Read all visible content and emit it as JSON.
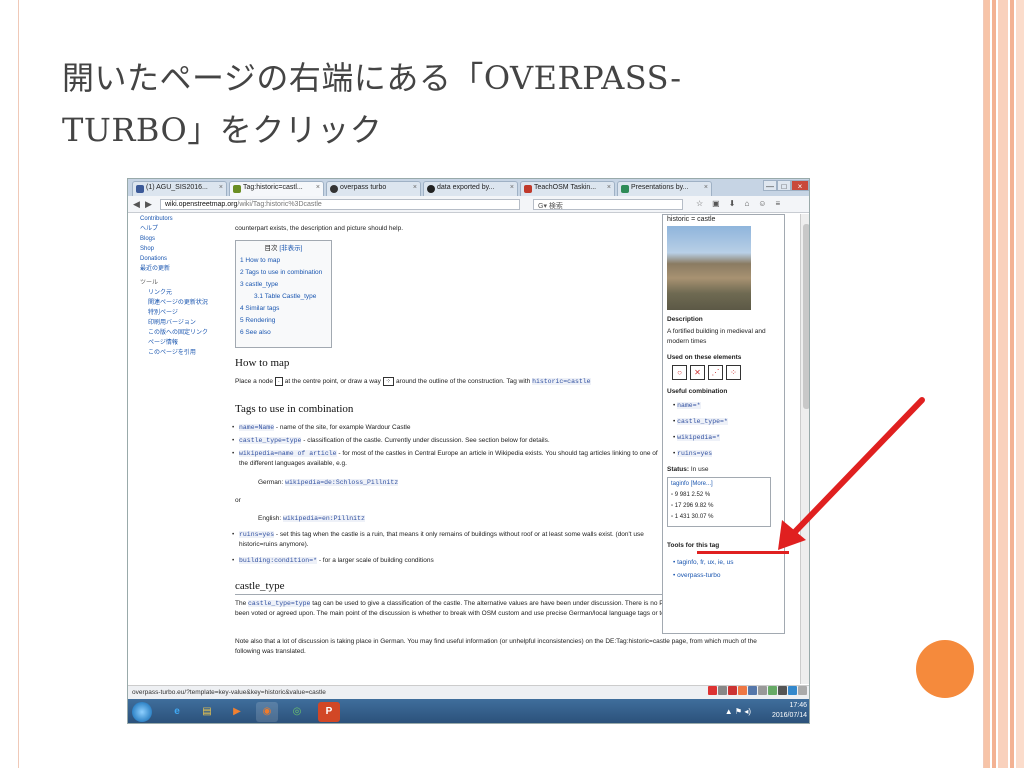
{
  "slide": {
    "title_line1": "開いたページの右端にある「OVERPASS-",
    "title_line2": "TURBO」をクリック"
  },
  "browser": {
    "tabs": [
      {
        "label": "(1) AGU_SIS2016...",
        "color": "#3b5998"
      },
      {
        "label": "Tag:historic=castl...",
        "color": "#6b8e23"
      },
      {
        "label": "overpass turbo",
        "color": "#333333"
      },
      {
        "label": "data exported by...",
        "color": "#222222"
      },
      {
        "label": "TeachOSM Taskin...",
        "color": "#c0392b"
      },
      {
        "label": "Presentations by...",
        "color": "#2e8b57"
      }
    ],
    "tab_close": "×",
    "window_buttons": [
      "—",
      "□",
      "×"
    ],
    "back": "◀",
    "forward": "▶",
    "url_host": "wiki.openstreetmap.org",
    "url_path": "/wiki/Tag:historic%3Dcastle",
    "search_placeholder": "検索",
    "toolbar_icons": [
      "☆",
      "▣",
      "⬇",
      "⌂",
      "☺",
      "≡"
    ]
  },
  "sidebar": {
    "items_top": [
      "Contributors",
      "ヘルプ",
      "Blogs",
      "Shop",
      "Donations",
      "最近の更新"
    ],
    "tools_heading": "ツール",
    "tools": [
      "リンク元",
      "関連ページの更新状況",
      "特別ページ",
      "印刷用バージョン",
      "この版への固定リンク",
      "ページ情報",
      "このページを引用"
    ]
  },
  "content": {
    "intro_line2": "counterpart exists, the description and picture should help.",
    "toc": {
      "title": "目次",
      "hide": "[非表示]",
      "items": [
        "1 How to map",
        "2 Tags to use in combination",
        "3 castle_type",
        "3.1 Table Castle_type",
        "4 Similar tags",
        "5 Rendering",
        "6 See also"
      ]
    },
    "how_to_map": {
      "heading": "How to map",
      "text_a": "Place a node",
      "text_b": "at the centre point, or draw a way",
      "text_c": "around the outline of the construction. Tag with",
      "tag": "historic=castle"
    },
    "combination": {
      "heading": "Tags to use in combination",
      "b1_code": "name=Name",
      "b1_text": "- name of the site, for example Wardour Castle",
      "b2_code": "castle_type=type",
      "b2_text": "- classification of the castle. Currently under discussion. See section below for details.",
      "b3_code": "wikipedia=name of article",
      "b3_text": "- for most of the castles in Central Europe an article in Wikipedia exists. You should tag articles linking to one of the different languages available, e.g.",
      "german_label": "German:",
      "german_code": "wikipedia=de:Schloss_Pillnitz",
      "or": "or",
      "english_label": "English:",
      "english_code": "wikipedia=en:Pillnitz",
      "b4_code": "ruins=yes",
      "b4_text": "- set this tag when the castle is a ruin, that means it only remains of buildings without roof or at least some walls exist. (don't use historic=ruins anymore).",
      "b5_code": "building:condition=*",
      "b5_text": "- for a larger scale of building conditions"
    },
    "castle_type": {
      "heading": "castle_type",
      "p1_a": "The",
      "p1_code": "castle_type=type",
      "p1_b": "tag can be used to give a classification of the castle. The alternative values are have been under discussion. There is no Proposal page yet and they have not been voted or agreed upon. The main point of the discussion is whether to break with OSM custom and use precise German/local language tags or to use more general English tags.",
      "p2": "Note also that a lot of discussion is taking place in German. You may find useful information (or unhelpful inconsistencies) on the DE:Tag:historic=castle page, from which much of the following was translated."
    }
  },
  "infobox": {
    "title": "historic = castle",
    "description_label": "Description",
    "description": "A fortified building in medieval and modern times",
    "used_on": "Used on these elements",
    "elements": [
      "○",
      "✕",
      "⋰",
      "⁘"
    ],
    "useful_label": "Useful combination",
    "useful": [
      "name=*",
      "castle_type=*",
      "wikipedia=*",
      "ruins=yes"
    ],
    "status_label": "Status:",
    "status": "In use",
    "taginfo_title": "taginfo [More...]",
    "stats": [
      "9 981  2.52 %",
      "17 296  9.82 %",
      "1 431  30.07 %"
    ],
    "tools_heading": "Tools for this tag",
    "tools": [
      "taginfo, fr, ux, ie, us",
      "overpass-turbo"
    ]
  },
  "statusbar": {
    "url": "overpass-turbo.eu/?template=key-value&key=historic&value=castle"
  },
  "taskbar": {
    "apps": [
      "e",
      "▤",
      "▶",
      "◉",
      "◎",
      "P"
    ],
    "time": "17:46",
    "date": "2016/07/14",
    "tray": "▲ ⚑ ◂)"
  },
  "colors": {
    "accent_red": "#e02020",
    "orange": "#f58a3c",
    "link": "#1a56b0"
  }
}
